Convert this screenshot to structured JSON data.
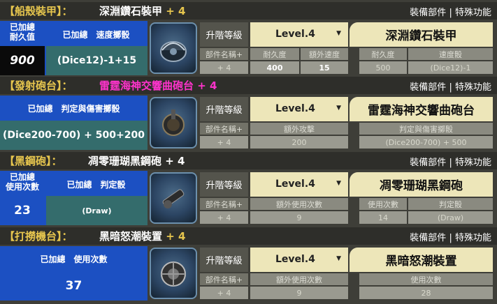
{
  "links": {
    "parts": "裝備部件",
    "sep": "|",
    "special": "特殊功能"
  },
  "sections": [
    {
      "bracket": "【船殼裝甲】：",
      "name": "深淵鑽石裝甲",
      "plus": "+ 4",
      "name_color": "#ffffff",
      "blue_labels": [
        "已加總\n耐久值",
        "已加總　速度擲骰"
      ],
      "blue_values": [
        "900",
        "(Dice12)-1+15"
      ],
      "level_label": "升階等級",
      "level_value": "Level.4",
      "item_title": "深淵鑽石裝甲",
      "cols": [
        "部件名稱+",
        "耐久度",
        "額外速度",
        "耐久度",
        "速度骰"
      ],
      "vals": [
        "+ 4",
        "400",
        "15",
        "500",
        "(Dice12)-1"
      ]
    },
    {
      "bracket": "【發射砲台】：",
      "name": "雷霆海神交響曲砲台",
      "plus": "+ 4",
      "name_color": "#ff33cc",
      "blue_labels": [
        "已加總　判定與傷害擲骰"
      ],
      "blue_values": [
        "(Dice200-700) + 500+200"
      ],
      "level_label": "升階等級",
      "level_value": "Level.4",
      "item_title": "雷霆海神交響曲砲台",
      "cols": [
        "部件名稱+",
        "額外攻擊",
        "判定與傷害擲骰"
      ],
      "vals": [
        "+ 4",
        "200",
        "(Dice200-700) + 500"
      ]
    },
    {
      "bracket": "【黑鋼砲】：",
      "name": "凋零珊瑚黑鋼砲",
      "plus": "+ 4",
      "name_color": "#ffffff",
      "blue_labels": [
        "已加總\n使用次數",
        "已加總　判定骰"
      ],
      "blue_values": [
        "23",
        "(Draw)"
      ],
      "level_label": "升階等級",
      "level_value": "Level.4",
      "item_title": "凋零珊瑚黑鋼砲",
      "cols": [
        "部件名稱+",
        "額外使用次數",
        "使用次數",
        "判定骰"
      ],
      "vals": [
        "+ 4",
        "9",
        "14",
        "(Draw)"
      ]
    },
    {
      "bracket": "【打撈機台】：",
      "name": "黑暗怒潮裝置",
      "plus": "+ 4",
      "name_color": "#ffffff",
      "blue_labels": [
        "已加總　使用次數"
      ],
      "blue_values": [
        "37"
      ],
      "level_label": "升階等級",
      "level_value": "Level.4",
      "item_title": "黑暗怒潮裝置",
      "cols": [
        "部件名稱+",
        "額外使用次數",
        "使用次數"
      ],
      "vals": [
        "+ 4",
        "9",
        "28"
      ]
    }
  ]
}
